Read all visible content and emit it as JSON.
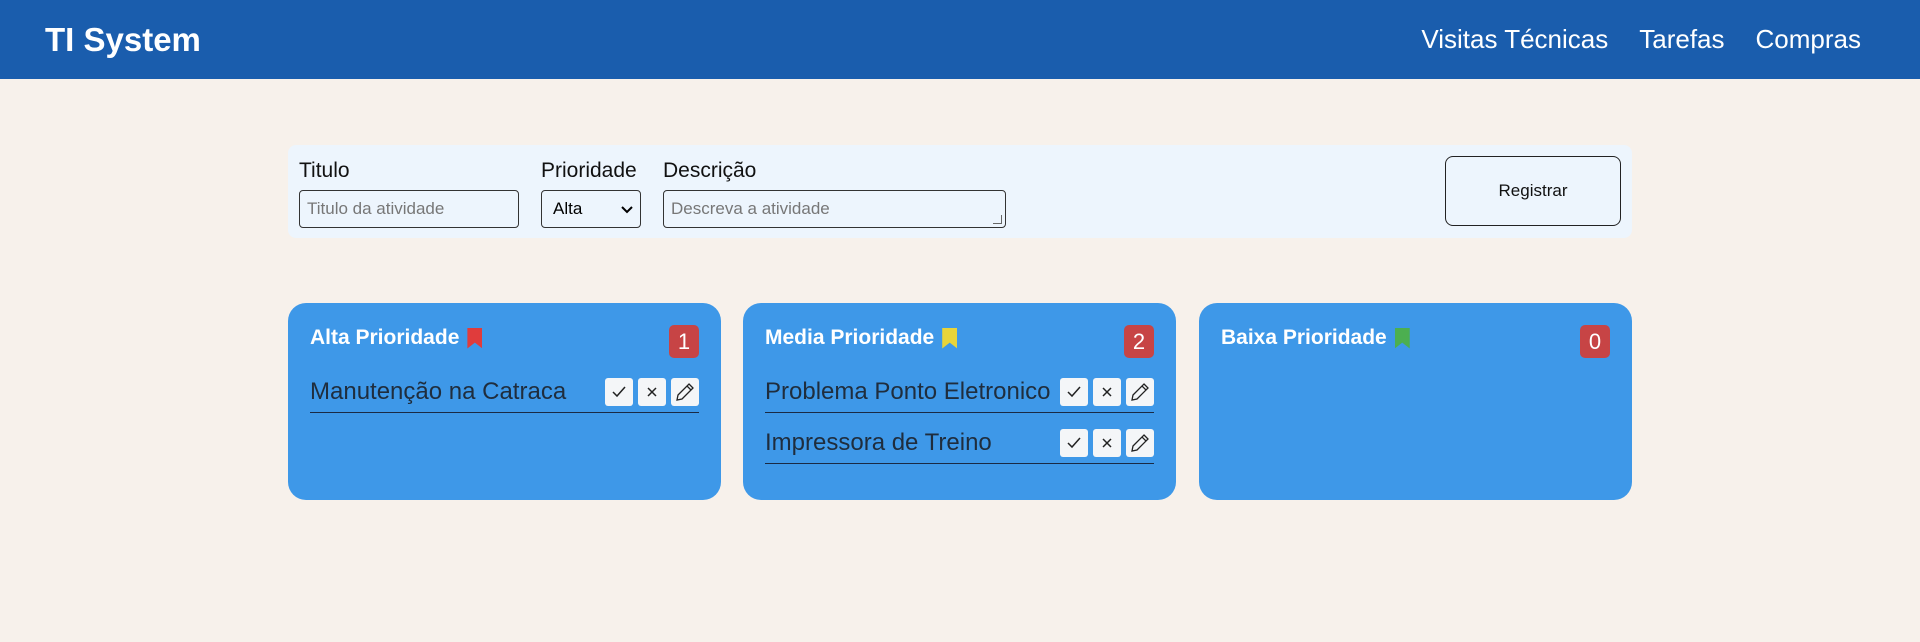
{
  "header": {
    "brand": "TI System",
    "nav": [
      "Visitas Técnicas",
      "Tarefas",
      "Compras"
    ]
  },
  "form": {
    "title_label": "Titulo",
    "title_placeholder": "Titulo da atividade",
    "priority_label": "Prioridade",
    "priority_value": "Alta",
    "description_label": "Descrição",
    "description_placeholder": "Descreva a atividade",
    "register_label": "Registrar"
  },
  "columns": [
    {
      "title": "Alta Prioridade",
      "flag_color": "#e03c3c",
      "count": "1",
      "tasks": [
        "Manutenção na Catraca"
      ]
    },
    {
      "title": "Media Prioridade",
      "flag_color": "#e8d43a",
      "count": "2",
      "tasks": [
        "Problema Ponto Eletronico",
        "Impressora de Treino"
      ]
    },
    {
      "title": "Baixa Prioridade",
      "flag_color": "#4caf50",
      "count": "0",
      "tasks": []
    }
  ],
  "icons": {
    "complete": "check-icon",
    "delete": "close-icon",
    "edit": "pencil-icon"
  }
}
